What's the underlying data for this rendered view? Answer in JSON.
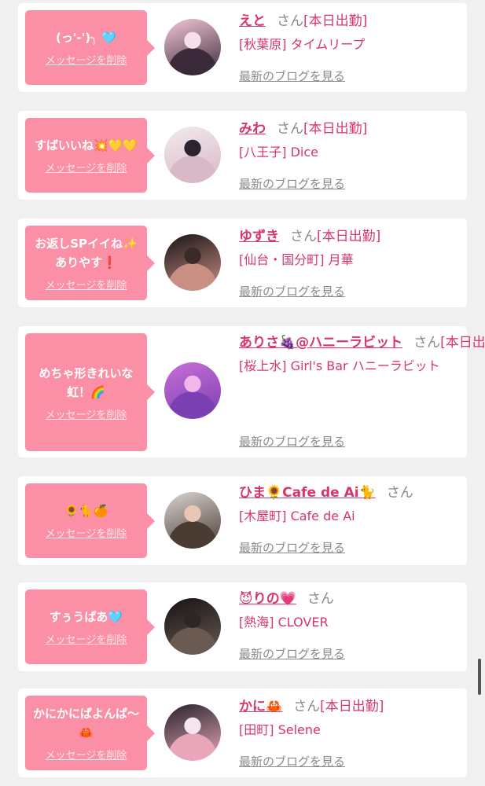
{
  "cards": [
    {
      "message": "(っ'-')╮ 🩵",
      "delete_label": "メッセージを削除",
      "name": "えと",
      "honorific": "さん",
      "status": "[本日出勤]",
      "shop": "[秋葉原] タイムリープ",
      "blog_label": "最新のブログを見る",
      "avatar_colors": [
        "#f4c7d8",
        "#3b2b3a",
        "#f6e1ea"
      ]
    },
    {
      "message": "すばいいね💥💛💛",
      "delete_label": "メッセージを削除",
      "name": "みわ",
      "honorific": "さん",
      "status": "[本日出勤]",
      "shop": "[八王子] Dice",
      "blog_label": "最新のブログを見る",
      "avatar_colors": [
        "#f3e9ee",
        "#d8b9c7",
        "#2b2430"
      ]
    },
    {
      "message": "お返しSPイイね✨ありやす❗",
      "delete_label": "メッセージを削除",
      "name": "ゆずき",
      "honorific": "さん",
      "status": "[本日出勤]",
      "shop": "[仙台・国分町] 月華",
      "blog_label": "最新のブログを見る",
      "avatar_colors": [
        "#1a1416",
        "#c98f83",
        "#3a2a2a"
      ]
    },
    {
      "message": "めちゃ形きれいな虹！🌈",
      "delete_label": "メッセージを削除",
      "name": "ありさ🍇@ハニーラビット",
      "honorific": "さん",
      "status": "[本日出勤]",
      "shop": "[桜上水] Girl's Bar ハニーラビット",
      "blog_label": "最新のブログを見る",
      "avatar_colors": [
        "#c86fd8",
        "#7a3fb0",
        "#f1b7e8"
      ]
    },
    {
      "message": "🌻🐈🍊",
      "delete_label": "メッセージを削除",
      "name": "ひま🌻Cafe de Ai🐈",
      "honorific": "さん",
      "status": "",
      "shop": "[木屋町] Cafe de Ai",
      "blog_label": "最新のブログを見る",
      "avatar_colors": [
        "#d9d3cf",
        "#4a3b33",
        "#e9c7b6"
      ]
    },
    {
      "message": "すぅうぱあ🩵",
      "delete_label": "メッセージを削除",
      "name": "😈りの💗",
      "honorific": "さん",
      "status": "",
      "shop": "[熱海] CLOVER",
      "blog_label": "最新のブログを見る",
      "avatar_colors": [
        "#151212",
        "#6b5a52",
        "#2d2626"
      ]
    },
    {
      "message": "かにかにぱよんぱ〜🦀",
      "delete_label": "メッセージを削除",
      "name": "かに🦀",
      "honorific": "さん",
      "status": "[本日出勤]",
      "shop": "[田町] Selene",
      "blog_label": "最新のブログを見る",
      "avatar_colors": [
        "#26222a",
        "#e8a6b8",
        "#f5e6ee"
      ]
    }
  ],
  "theme": {
    "accent": "#d9356a",
    "bubble": "#fb8fa5",
    "background": "#f0f0f0"
  }
}
